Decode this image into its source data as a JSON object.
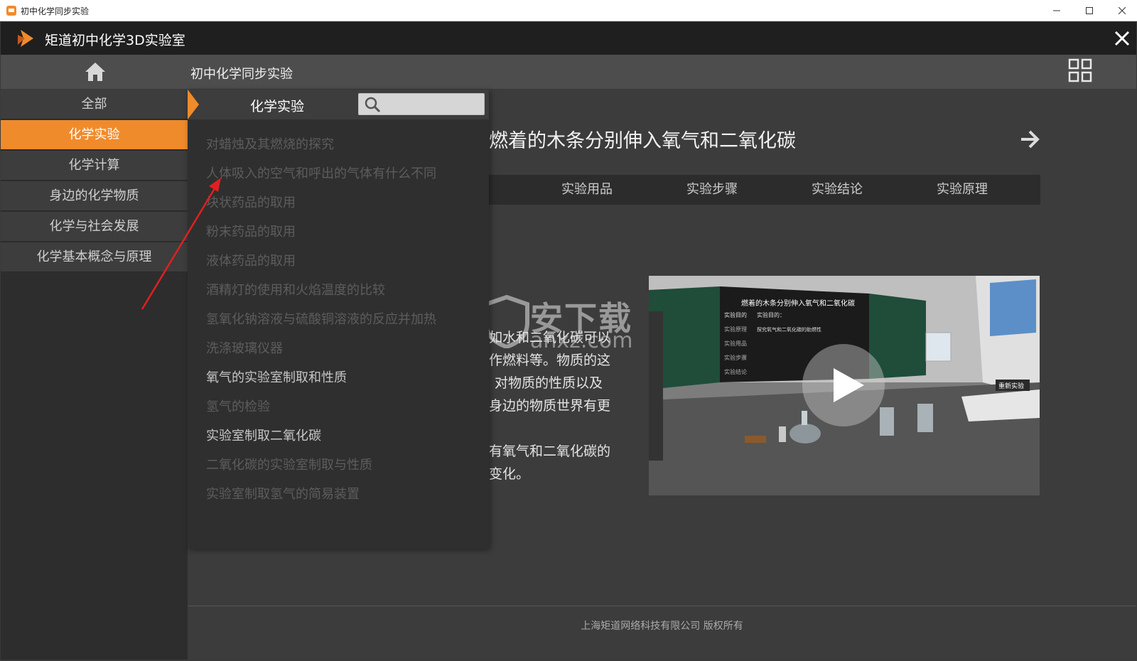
{
  "window": {
    "title": "初中化学同步实验",
    "minimize": "—",
    "maximize": "☐",
    "close": "✕"
  },
  "app": {
    "title": "矩道初中化学3D实验室",
    "accent_color": "#f08b2c"
  },
  "nav": {
    "title": "初中化学同步实验",
    "home_icon": "home-icon",
    "grid_icon": "grid-view-icon"
  },
  "sidebar": {
    "items": [
      {
        "label": "全部",
        "active": false
      },
      {
        "label": "化学实验",
        "active": true
      },
      {
        "label": "化学计算",
        "active": false
      },
      {
        "label": "身边的化学物质",
        "active": false
      },
      {
        "label": "化学与社会发展",
        "active": false
      },
      {
        "label": "化学基本概念与原理",
        "active": false
      }
    ]
  },
  "dropdown": {
    "title": "化学实验",
    "search_placeholder": "",
    "items": [
      {
        "label": "对蜡烛及其燃烧的探究",
        "enabled": false
      },
      {
        "label": "人体吸入的空气和呼出的气体有什么不同",
        "enabled": false
      },
      {
        "label": "块状药品的取用",
        "enabled": false
      },
      {
        "label": "粉末药品的取用",
        "enabled": false
      },
      {
        "label": "液体药品的取用",
        "enabled": false
      },
      {
        "label": "酒精灯的使用和火焰温度的比较",
        "enabled": false
      },
      {
        "label": "氢氧化钠溶液与硫酸铜溶液的反应并加热",
        "enabled": false
      },
      {
        "label": "洗涤玻璃仪器",
        "enabled": false
      },
      {
        "label": "氧气的实验室制取和性质",
        "enabled": true
      },
      {
        "label": "氢气的检验",
        "enabled": false
      },
      {
        "label": "实验室制取二氧化碳",
        "enabled": true
      },
      {
        "label": "二氧化碳的实验室制取与性质",
        "enabled": false
      },
      {
        "label": "实验室制取氢气的简易装置",
        "enabled": false
      }
    ]
  },
  "detail": {
    "title": "燃着的木条分别伸入氧气和二氧化碳",
    "tabs": [
      "实验用品",
      "实验步骤",
      "实验结论",
      "实验原理"
    ],
    "description_lines": [
      "如水和二氧化碳可以",
      "作燃料等。物质的这",
      "对物质的性质以及",
      "身边的物质世界有更",
      "有氧气和二氧化碳的",
      "变化。"
    ]
  },
  "video": {
    "board_title": "燃着的木条分别伸入氧气和二氧化碳",
    "board_labels": [
      "实验目的",
      "实验原理",
      "实验用品",
      "实验步骤",
      "实验结论"
    ],
    "board_body": [
      "实验目的：",
      "探究氧气和二氧化碳的助燃性"
    ],
    "restart_label": "重新实验",
    "play_icon": "play-icon"
  },
  "watermark": {
    "line1": "安下载",
    "line2": "anxz.com"
  },
  "footer": {
    "copyright": "上海矩道网络科技有限公司  版权所有"
  }
}
